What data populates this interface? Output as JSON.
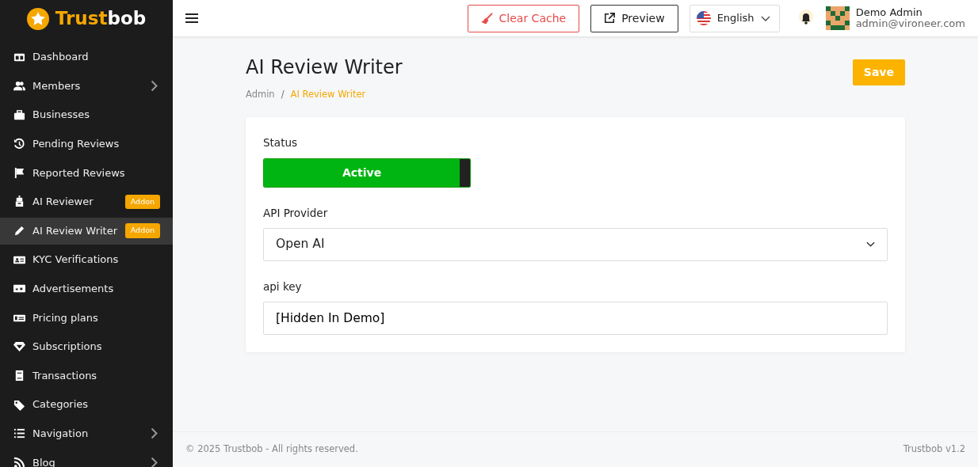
{
  "logo": {
    "accent": "Trust",
    "rest": "bob"
  },
  "sidebar": {
    "items": [
      {
        "label": "Dashboard",
        "selected": false
      },
      {
        "label": "Members",
        "selected": false,
        "submenu": true
      },
      {
        "label": "Businesses",
        "selected": false
      },
      {
        "label": "Pending Reviews",
        "selected": false
      },
      {
        "label": "Reported Reviews",
        "selected": false
      },
      {
        "label": "AI Reviewer",
        "selected": false,
        "badge": "Addon"
      },
      {
        "label": "AI Review Writer",
        "selected": true,
        "badge": "Addon"
      },
      {
        "label": "KYC Verifications",
        "selected": false
      },
      {
        "label": "Advertisements",
        "selected": false
      },
      {
        "label": "Pricing plans",
        "selected": false
      },
      {
        "label": "Subscriptions",
        "selected": false
      },
      {
        "label": "Transactions",
        "selected": false
      },
      {
        "label": "Categories",
        "selected": false
      },
      {
        "label": "Navigation",
        "selected": false,
        "submenu": true
      },
      {
        "label": "Blog",
        "selected": false,
        "submenu": true
      }
    ]
  },
  "topbar": {
    "clear_cache": "Clear Cache",
    "preview": "Preview",
    "language": "English",
    "user": {
      "name": "Demo Admin",
      "email": "admin@vironeer.com"
    }
  },
  "page": {
    "title": "AI Review Writer",
    "breadcrumb": [
      "Admin",
      "AI Review Writer"
    ],
    "breadcrumb_separator": "/",
    "save": "Save"
  },
  "form": {
    "status": {
      "label": "Status",
      "on": true,
      "on_text": "Active"
    },
    "provider": {
      "label": "API Provider",
      "value": "Open AI"
    },
    "api_key": {
      "label": "api key",
      "value": "[Hidden In Demo]"
    }
  },
  "footer": {
    "copyright": "© 2025 Trustbob - All rights reserved.",
    "version": "Trustbob v1.2"
  }
}
